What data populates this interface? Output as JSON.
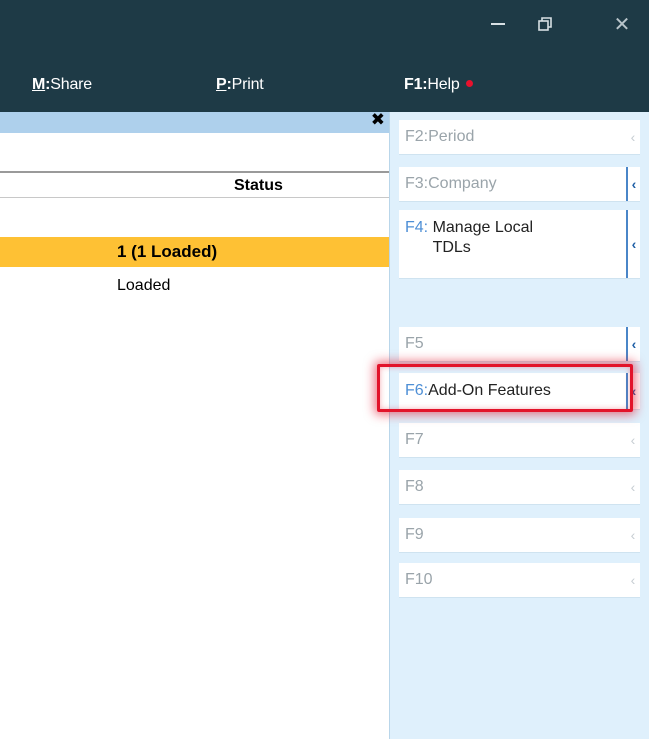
{
  "menu": {
    "share": {
      "key": "M",
      "label": "Share"
    },
    "print": {
      "key": "P",
      "label": "Print"
    },
    "help": {
      "key": "F1",
      "label": "Help"
    }
  },
  "report": {
    "status_header": "Status",
    "highlight_row": "1 (1 Loaded)",
    "row_text": "Loaded"
  },
  "buttons": [
    {
      "key": "F2",
      "label": "Period"
    },
    {
      "key": "F3",
      "label": "Company"
    },
    {
      "key": "F4",
      "label": "Manage Local TDLs"
    },
    {
      "key": "F5",
      "label": ""
    },
    {
      "key": "F6",
      "label": "Add-On Features"
    },
    {
      "key": "F7",
      "label": ""
    },
    {
      "key": "F8",
      "label": ""
    },
    {
      "key": "F9",
      "label": ""
    },
    {
      "key": "F10",
      "label": ""
    }
  ],
  "colors": {
    "titlebar": "#1e3a46",
    "highlight_row": "#fec134",
    "panel_header": "#aed0ec",
    "button_panel": "#dff0fc",
    "callout": "#e2132a",
    "key_active": "#4e8fd6",
    "help_dot": "#e8112d"
  },
  "icons": {
    "minimize": "minimize-icon",
    "restore": "restore-icon",
    "close": "close-icon",
    "panel_close": "close-icon",
    "chevron": "chevron-left-icon"
  }
}
